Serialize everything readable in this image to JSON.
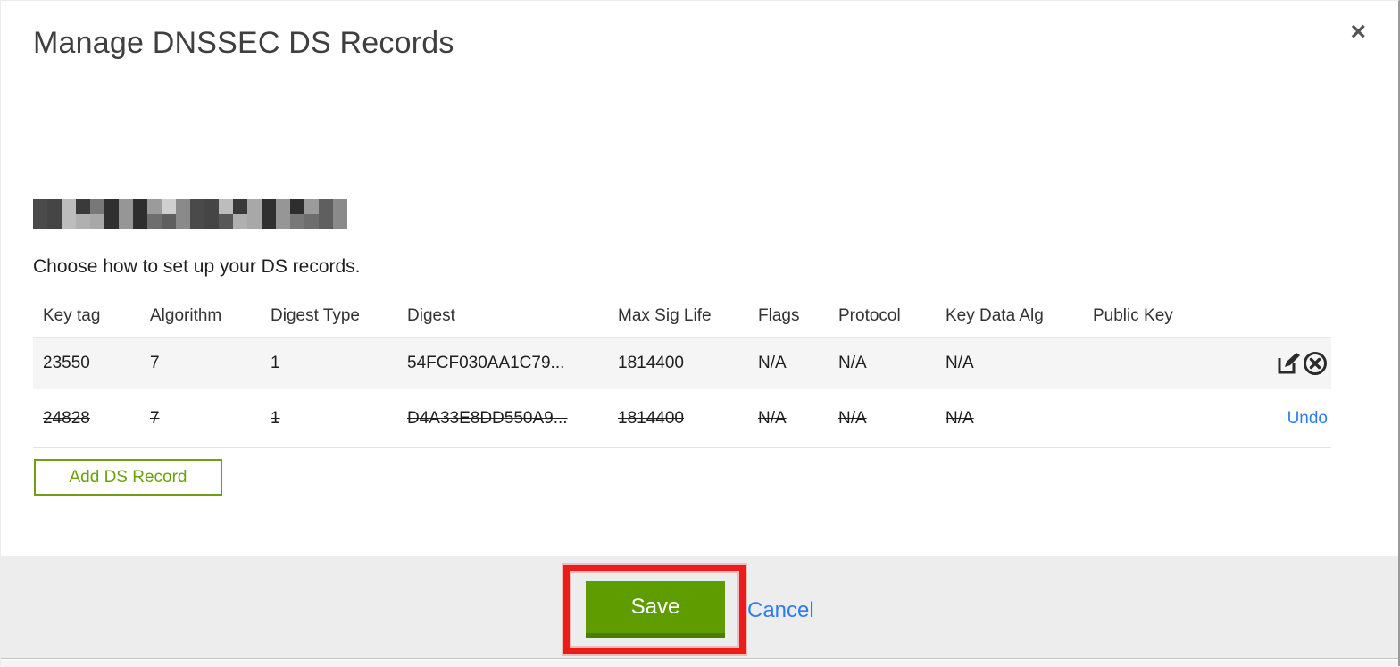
{
  "modal": {
    "title": "Manage DNSSEC DS Records",
    "close_label": "×"
  },
  "domain": {
    "redacted": true
  },
  "intro_text": "Choose how to set up your DS records.",
  "table": {
    "columns": [
      "Key tag",
      "Algorithm",
      "Digest Type",
      "Digest",
      "Max Sig Life",
      "Flags",
      "Protocol",
      "Key Data Alg",
      "Public Key"
    ],
    "rows": [
      {
        "key_tag": "23550",
        "algorithm": "7",
        "digest_type": "1",
        "digest": "54FCF030AA1C79...",
        "max_sig_life": "1814400",
        "flags": "N/A",
        "protocol": "N/A",
        "key_data_alg": "N/A",
        "public_key": "",
        "state": "active",
        "actions": [
          "edit",
          "delete"
        ]
      },
      {
        "key_tag": "24828",
        "algorithm": "7",
        "digest_type": "1",
        "digest": "D4A33E8DD550A9...",
        "max_sig_life": "1814400",
        "flags": "N/A",
        "protocol": "N/A",
        "key_data_alg": "N/A",
        "public_key": "",
        "state": "deleted",
        "action_label": "Undo"
      }
    ]
  },
  "buttons": {
    "add_ds_record": "Add DS Record",
    "save": "Save",
    "cancel": "Cancel"
  },
  "colors": {
    "save_green": "#5f9c00",
    "save_green_shadow": "#4c7d00",
    "outline_green": "#6ba10e",
    "link_blue": "#2e7df0",
    "annotation_red": "#ea1c1c",
    "row_highlight": "#f5f5f5",
    "footer_gray": "#ededed"
  }
}
